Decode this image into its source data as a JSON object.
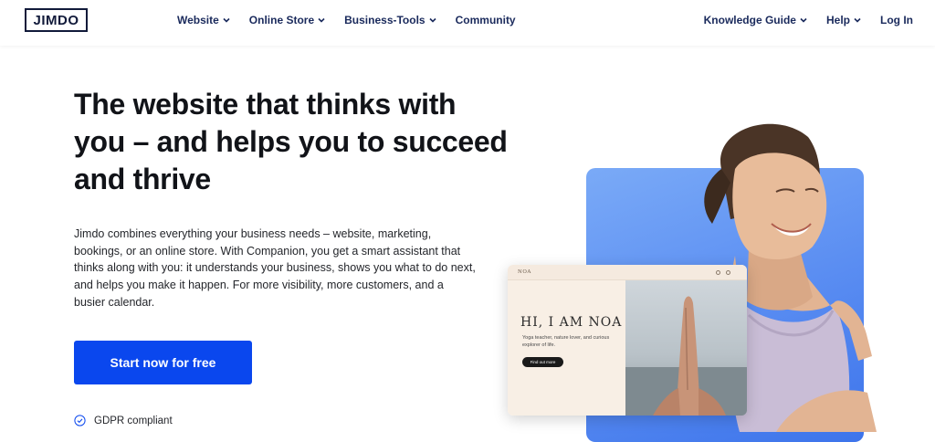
{
  "header": {
    "logo": "JIMDO",
    "nav_left": [
      {
        "label": "Website",
        "dropdown": true
      },
      {
        "label": "Online Store",
        "dropdown": true
      },
      {
        "label": "Business-Tools",
        "dropdown": true
      },
      {
        "label": "Community",
        "dropdown": false
      }
    ],
    "nav_right": [
      {
        "label": "Knowledge Guide",
        "dropdown": true
      },
      {
        "label": "Help",
        "dropdown": true
      },
      {
        "label": "Log In",
        "dropdown": false
      }
    ]
  },
  "hero": {
    "headline": "The website that thinks with you – and helps you to succeed and thrive",
    "body": "Jimdo combines everything your business needs – website, marketing, bookings, or an online store. With Companion, you get a smart assistant that thinks along with you: it understands your business, shows you what to do next, and helps you make it happen. For more visibility, more customers, and a busier calendar.",
    "cta_label": "Start now for free",
    "gdpr_label": "GDPR compliant"
  },
  "mockup": {
    "brand": "NOA",
    "title": "HI, I AM NOA",
    "subtitle": "Yoga teacher, nature lover, and curious explorer of life.",
    "button": "Find out more"
  },
  "colors": {
    "accent": "#0a47ee",
    "nav_text": "#1a2a5c",
    "card_blue": "#5b8ef2"
  },
  "icons": {
    "chevron": "chevron-down-icon",
    "gdpr": "check-circle-icon"
  }
}
